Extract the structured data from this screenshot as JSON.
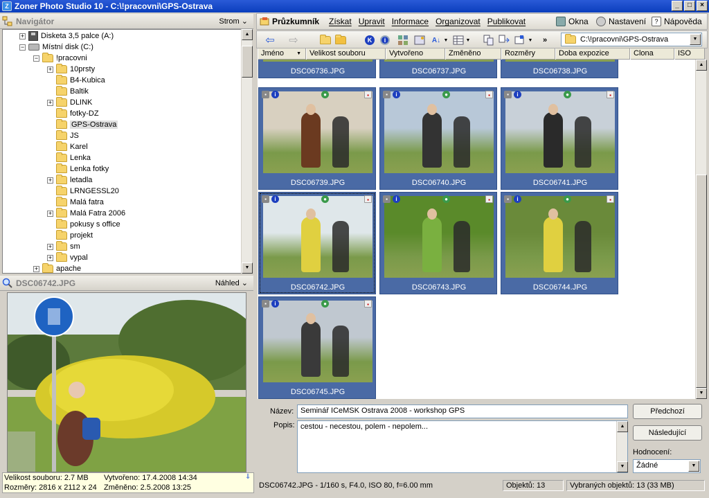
{
  "window": {
    "title": "Zoner Photo Studio 10 - C:\\!pracovni\\GPS-Ostrava"
  },
  "navigator": {
    "title": "Navigátor",
    "mode": "Strom",
    "tree": [
      {
        "label": "Disketa 3,5 palce (A:)",
        "indent": 0,
        "expander": "+",
        "icon": "floppy"
      },
      {
        "label": "Místní disk (C:)",
        "indent": 0,
        "expander": "-",
        "icon": "drive"
      },
      {
        "label": "!pracovni",
        "indent": 1,
        "expander": "-",
        "icon": "folder"
      },
      {
        "label": "10prsty",
        "indent": 2,
        "expander": "+",
        "icon": "folder"
      },
      {
        "label": "B4-Kubica",
        "indent": 2,
        "expander": "",
        "icon": "folder"
      },
      {
        "label": "Baltik",
        "indent": 2,
        "expander": "",
        "icon": "folder"
      },
      {
        "label": "DLINK",
        "indent": 2,
        "expander": "+",
        "icon": "folder"
      },
      {
        "label": "fotky-DZ",
        "indent": 2,
        "expander": "",
        "icon": "folder"
      },
      {
        "label": "GPS-Ostrava",
        "indent": 2,
        "expander": "",
        "icon": "folder",
        "selected": true
      },
      {
        "label": "JS",
        "indent": 2,
        "expander": "",
        "icon": "folder"
      },
      {
        "label": "Karel",
        "indent": 2,
        "expander": "",
        "icon": "folder"
      },
      {
        "label": "Lenka",
        "indent": 2,
        "expander": "",
        "icon": "folder"
      },
      {
        "label": "Lenka fotky",
        "indent": 2,
        "expander": "",
        "icon": "folder"
      },
      {
        "label": "letadla",
        "indent": 2,
        "expander": "+",
        "icon": "folder"
      },
      {
        "label": "LRNGESSL20",
        "indent": 2,
        "expander": "",
        "icon": "folder"
      },
      {
        "label": "Malá fatra",
        "indent": 2,
        "expander": "",
        "icon": "folder"
      },
      {
        "label": "Malá Fatra 2006",
        "indent": 2,
        "expander": "+",
        "icon": "folder"
      },
      {
        "label": "pokusy s office",
        "indent": 2,
        "expander": "",
        "icon": "folder"
      },
      {
        "label": "projekt",
        "indent": 2,
        "expander": "",
        "icon": "folder"
      },
      {
        "label": "sm",
        "indent": 2,
        "expander": "+",
        "icon": "folder"
      },
      {
        "label": "vypal",
        "indent": 2,
        "expander": "+",
        "icon": "folder"
      },
      {
        "label": "apache",
        "indent": 1,
        "expander": "+",
        "icon": "folder"
      }
    ]
  },
  "preview": {
    "title": "DSC06742.JPG",
    "mode": "Náhled",
    "size_label": "Velikost souboru: 2.7 MB",
    "created_label": "Vytvořeno: 17.4.2008 14:34",
    "dims_label": "Rozměry: 2816 x 2112 x 24",
    "modified_label": "Změněno: 2.5.2008 13:25"
  },
  "menu": {
    "explorer": "Průzkumník",
    "items": [
      "Získat",
      "Upravit",
      "Informace",
      "Organizovat",
      "Publikovat"
    ],
    "windows": "Okna",
    "settings": "Nastavení",
    "help": "Nápověda"
  },
  "address": {
    "path": "C:\\!pracovni\\GPS-Ostrava"
  },
  "columns": [
    "Jméno",
    "Velikost souboru",
    "Vytvořeno",
    "Změněno",
    "Rozměry",
    "Doba expozice",
    "Clona",
    "ISO"
  ],
  "thumbnails": [
    {
      "name": "DSC06736.JPG",
      "partial": true
    },
    {
      "name": "DSC06737.JPG",
      "partial": true
    },
    {
      "name": "DSC06738.JPG",
      "partial": true
    },
    {
      "name": "DSC06739.JPG"
    },
    {
      "name": "DSC06740.JPG"
    },
    {
      "name": "DSC06741.JPG"
    },
    {
      "name": "DSC06742.JPG",
      "selected": true
    },
    {
      "name": "DSC06743.JPG"
    },
    {
      "name": "DSC06744.JPG"
    },
    {
      "name": "DSC06745.JPG"
    }
  ],
  "edit": {
    "name_label": "Název:",
    "name_value": "Seminář ICeMSK Ostrava 2008 - workshop GPS",
    "desc_label": "Popis:",
    "desc_value": "cestou - necestou, polem - nepolem...",
    "prev_button": "Předchozí",
    "next_button": "Následující",
    "rating_label": "Hodnocení:",
    "rating_value": "Žádné"
  },
  "status": {
    "exif": "DSC06742.JPG - 1/160 s, F4.0, ISO 80, f=6.00 mm",
    "objects": "Objektů: 13",
    "selected": "Vybraných objektů: 13 (33 MB)"
  }
}
